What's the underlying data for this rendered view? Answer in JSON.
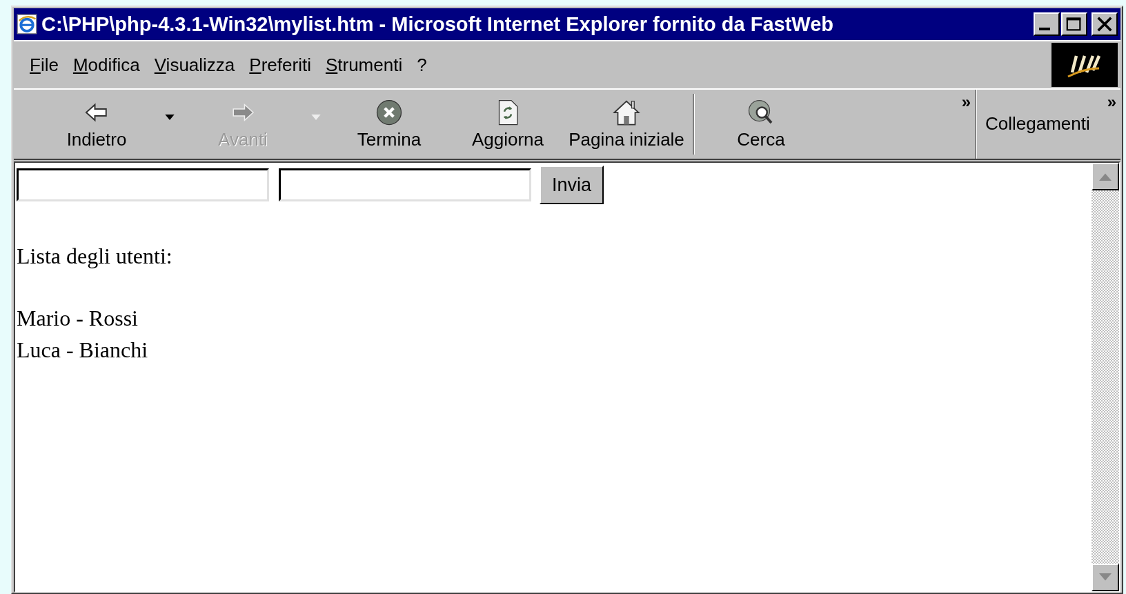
{
  "window": {
    "title": "C:\\PHP\\php-4.3.1-Win32\\mylist.htm - Microsoft Internet Explorer fornito da FastWeb"
  },
  "menu": [
    "File",
    "Modifica",
    "Visualizza",
    "Preferiti",
    "Strumenti",
    "?"
  ],
  "toolbar": {
    "buttons": [
      {
        "kind": "back",
        "label": "Indietro",
        "disabled": false,
        "dropdown": true
      },
      {
        "kind": "forward",
        "label": "Avanti",
        "disabled": true,
        "dropdown": true
      },
      {
        "kind": "stop",
        "label": "Termina",
        "disabled": false,
        "dropdown": false
      },
      {
        "kind": "refresh",
        "label": "Aggiorna",
        "disabled": false,
        "dropdown": false
      },
      {
        "kind": "home",
        "label": "Pagina iniziale",
        "disabled": false,
        "dropdown": false
      },
      {
        "kind": "search",
        "label": "Cerca",
        "disabled": false,
        "dropdown": false
      }
    ],
    "overflow": "»"
  },
  "links_bar": {
    "label": "Collegamenti",
    "overflow": "»"
  },
  "page": {
    "submit": "Invia",
    "heading": "Lista degli utenti:",
    "users": [
      "Mario - Rossi",
      "Luca - Bianchi"
    ]
  }
}
